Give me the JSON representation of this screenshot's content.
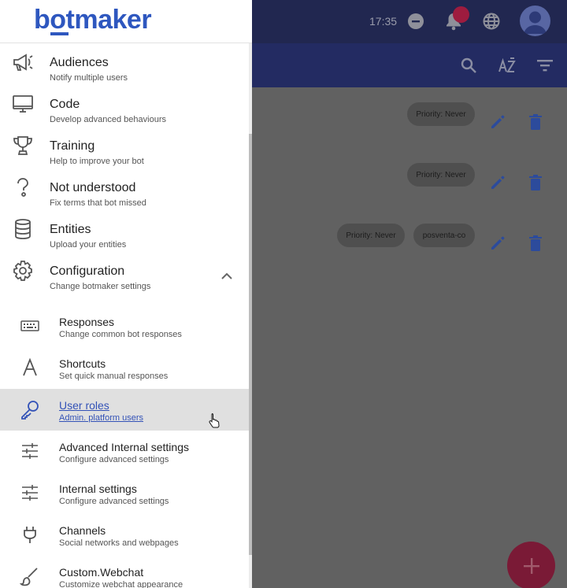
{
  "header": {
    "logo_text": "botmaker",
    "time": "17:35"
  },
  "toolbar": {
    "icons": [
      "search-icon",
      "sort-az-icon",
      "filter-icon"
    ]
  },
  "rows": [
    {
      "chips": [
        "Priority: Never"
      ]
    },
    {
      "chips": [
        "Priority: Never"
      ]
    },
    {
      "chips": [
        "Priority: Never",
        "posventa-co"
      ]
    }
  ],
  "menu": {
    "items": [
      {
        "title": "Audiences",
        "subtitle": "Notify multiple users",
        "icon": "megaphone-icon"
      },
      {
        "title": "Code",
        "subtitle": "Develop advanced behaviours",
        "icon": "monitor-icon"
      },
      {
        "title": "Training",
        "subtitle": "Help to improve your bot",
        "icon": "trophy-icon"
      },
      {
        "title": "Not understood",
        "subtitle": "Fix terms that bot missed",
        "icon": "question-icon"
      },
      {
        "title": "Entities",
        "subtitle": "Upload your entities",
        "icon": "database-icon"
      },
      {
        "title": "Configuration",
        "subtitle": "Change botmaker settings",
        "icon": "gear-icon"
      }
    ],
    "sub_items": [
      {
        "title": "Responses",
        "subtitle": "Change common bot responses",
        "icon": "keyboard-icon"
      },
      {
        "title": "Shortcuts",
        "subtitle": "Set quick manual responses",
        "icon": "font-a-icon"
      },
      {
        "title": "User roles",
        "subtitle": "Admin. platform users",
        "icon": "key-icon",
        "active": true
      },
      {
        "title": "Advanced Internal settings",
        "subtitle": "Configure advanced settings",
        "icon": "sliders-icon"
      },
      {
        "title": "Internal settings",
        "subtitle": "Configure advanced settings",
        "icon": "sliders-icon"
      },
      {
        "title": "Channels",
        "subtitle": "Social networks and webpages",
        "icon": "plug-icon"
      },
      {
        "title": "Custom.Webchat",
        "subtitle": "Customize webchat appearance",
        "icon": "brush-icon"
      }
    ]
  },
  "colors": {
    "brand": "#2e57bf",
    "active_bg": "#e0e0e0",
    "fab": "#7a1a36"
  }
}
